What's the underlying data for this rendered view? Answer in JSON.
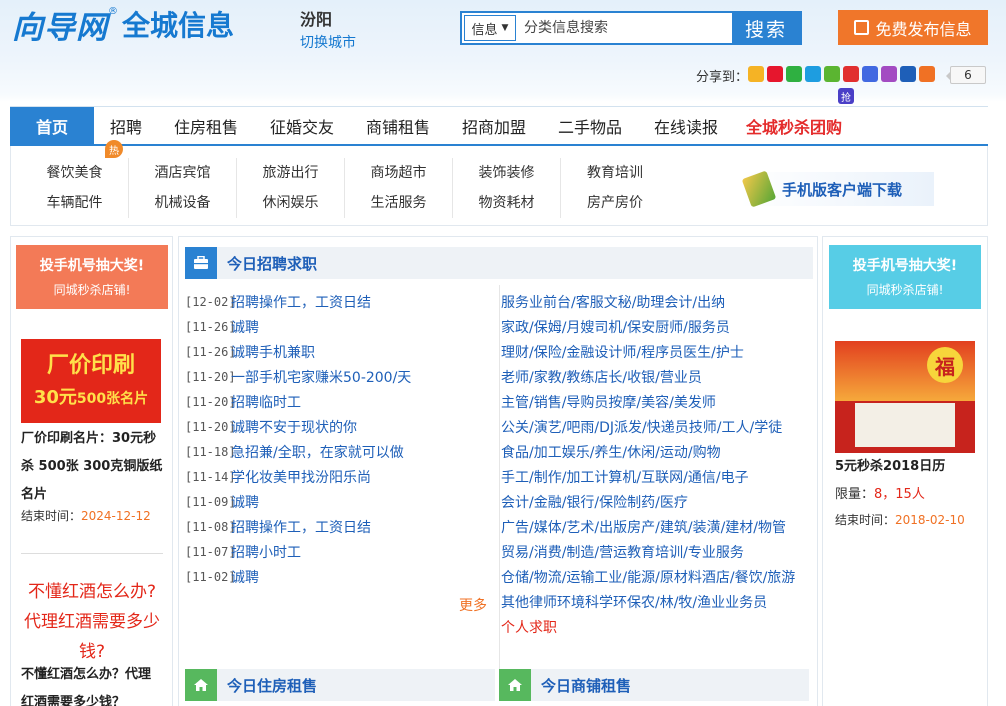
{
  "header": {
    "logo_text": "向导网",
    "logo_reg": "®",
    "logo_sub": "全城信息",
    "city": "汾阳",
    "switch_city": "切换城市",
    "search_select": "信息",
    "search_placeholder": "分类信息搜索",
    "search_button": "搜索",
    "publish_button": "免费发布信息",
    "share_label": "分享到：",
    "share_count": "6",
    "share_badge": "抢",
    "share_icons": [
      "qzone-icon",
      "weibo-icon",
      "wechat-icon",
      "tqq-icon",
      "douban-icon",
      "renren-icon",
      "baidu-icon",
      "kaixin-icon",
      "people-icon",
      "more-icon"
    ],
    "share_colors": [
      "#f5b325",
      "#e6162d",
      "#2fb041",
      "#1e9de0",
      "#5bb531",
      "#e12f2f",
      "#4169e1",
      "#a34bc2",
      "#1e5fb8",
      "#f07124"
    ]
  },
  "nav": {
    "items": [
      {
        "label": "首页"
      },
      {
        "label": "招聘"
      },
      {
        "label": "住房租售"
      },
      {
        "label": "征婚交友"
      },
      {
        "label": "商铺租售"
      },
      {
        "label": "招商加盟"
      },
      {
        "label": "二手物品"
      },
      {
        "label": "在线读报"
      },
      {
        "label": "全城秒杀团购"
      }
    ]
  },
  "subnav": {
    "hot_badge": "热",
    "columns": [
      [
        "餐饮美食",
        "车辆配件"
      ],
      [
        "酒店宾馆",
        "机械设备"
      ],
      [
        "旅游出行",
        "休闲娱乐"
      ],
      [
        "商场超市",
        "生活服务"
      ],
      [
        "装饰装修",
        "物资耗材"
      ],
      [
        "教育培训",
        "房产房价"
      ]
    ],
    "mobile_download": "手机版客户端下载"
  },
  "left": {
    "promo_a": "投手机号抽大奖!",
    "promo_b": "同城秒杀店铺!",
    "print_ad_1": "厂价印刷",
    "print_ad_2a": "30元",
    "print_ad_2b": "500张名片",
    "product1_title": "厂价印刷名片：30元秒杀 500张 300克铜版纸名片",
    "end_label": "结束时间：",
    "product1_end": "2024-12-12",
    "wine_1": "不懂红酒怎么办?",
    "wine_2": "代理红酒需要多少钱?",
    "product2_title": "不懂红酒怎么办？代理红酒需要多少钱？"
  },
  "right": {
    "promo_a": "投手机号抽大奖!",
    "promo_b": "同城秒杀店铺!",
    "fu_char": "福",
    "product_title": "5元秒杀2018日历",
    "limit_label": "限量：",
    "limit_value": "8，15人",
    "end_label": "结束时间：",
    "product_end": "2018-02-10"
  },
  "center": {
    "jobs_title": "今日招聘求职",
    "jobs": [
      {
        "date": "[12-02]",
        "title": "招聘操作工，工资日结"
      },
      {
        "date": "[11-26]",
        "title": "诚聘"
      },
      {
        "date": "[11-26]",
        "title": "诚聘手机兼职"
      },
      {
        "date": "[11-20]",
        "title": "一部手机宅家赚米50-200/天"
      },
      {
        "date": "[11-20]",
        "title": "招聘临时工"
      },
      {
        "date": "[11-20]",
        "title": "诚聘不安于现状的你"
      },
      {
        "date": "[11-18]",
        "title": "急招兼/全职，在家就可以做"
      },
      {
        "date": "[11-14]",
        "title": "学化妆美甲找汾阳乐尚"
      },
      {
        "date": "[11-09]",
        "title": "诚聘"
      },
      {
        "date": "[11-08]",
        "title": "招聘操作工，工资日结"
      },
      {
        "date": "[11-07]",
        "title": "招聘小时工"
      },
      {
        "date": "[11-02]",
        "title": "诚聘"
      }
    ],
    "more": "更多",
    "categories": [
      "服务业前台/客服文秘/助理会计/出纳",
      "家政/保姆/月嫂司机/保安厨师/服务员",
      "理财/保险/金融设计师/程序员医生/护士",
      "老师/家教/教练店长/收银/营业员",
      "主管/销售/导购员按摩/美容/美发师",
      "公关/演艺/吧雨/DJ派发/快递员技师/工人/学徒",
      "食品/加工娱乐/养生/休闲/运动/购物",
      "手工/制作/加工计算机/互联网/通信/电子",
      "会计/金融/银行/保险制药/医疗",
      "广告/媒体/艺术/出版房产/建筑/装潢/建材/物管",
      "贸易/消费/制造/营运教育培训/专业服务",
      "仓储/物流/运输工业/能源/原材料酒店/餐饮/旅游",
      "其他律师环境科学环保农/林/牧/渔业业务员",
      "个人求职"
    ],
    "housing_title": "今日住房租售",
    "shop_title": "今日商铺租售"
  }
}
